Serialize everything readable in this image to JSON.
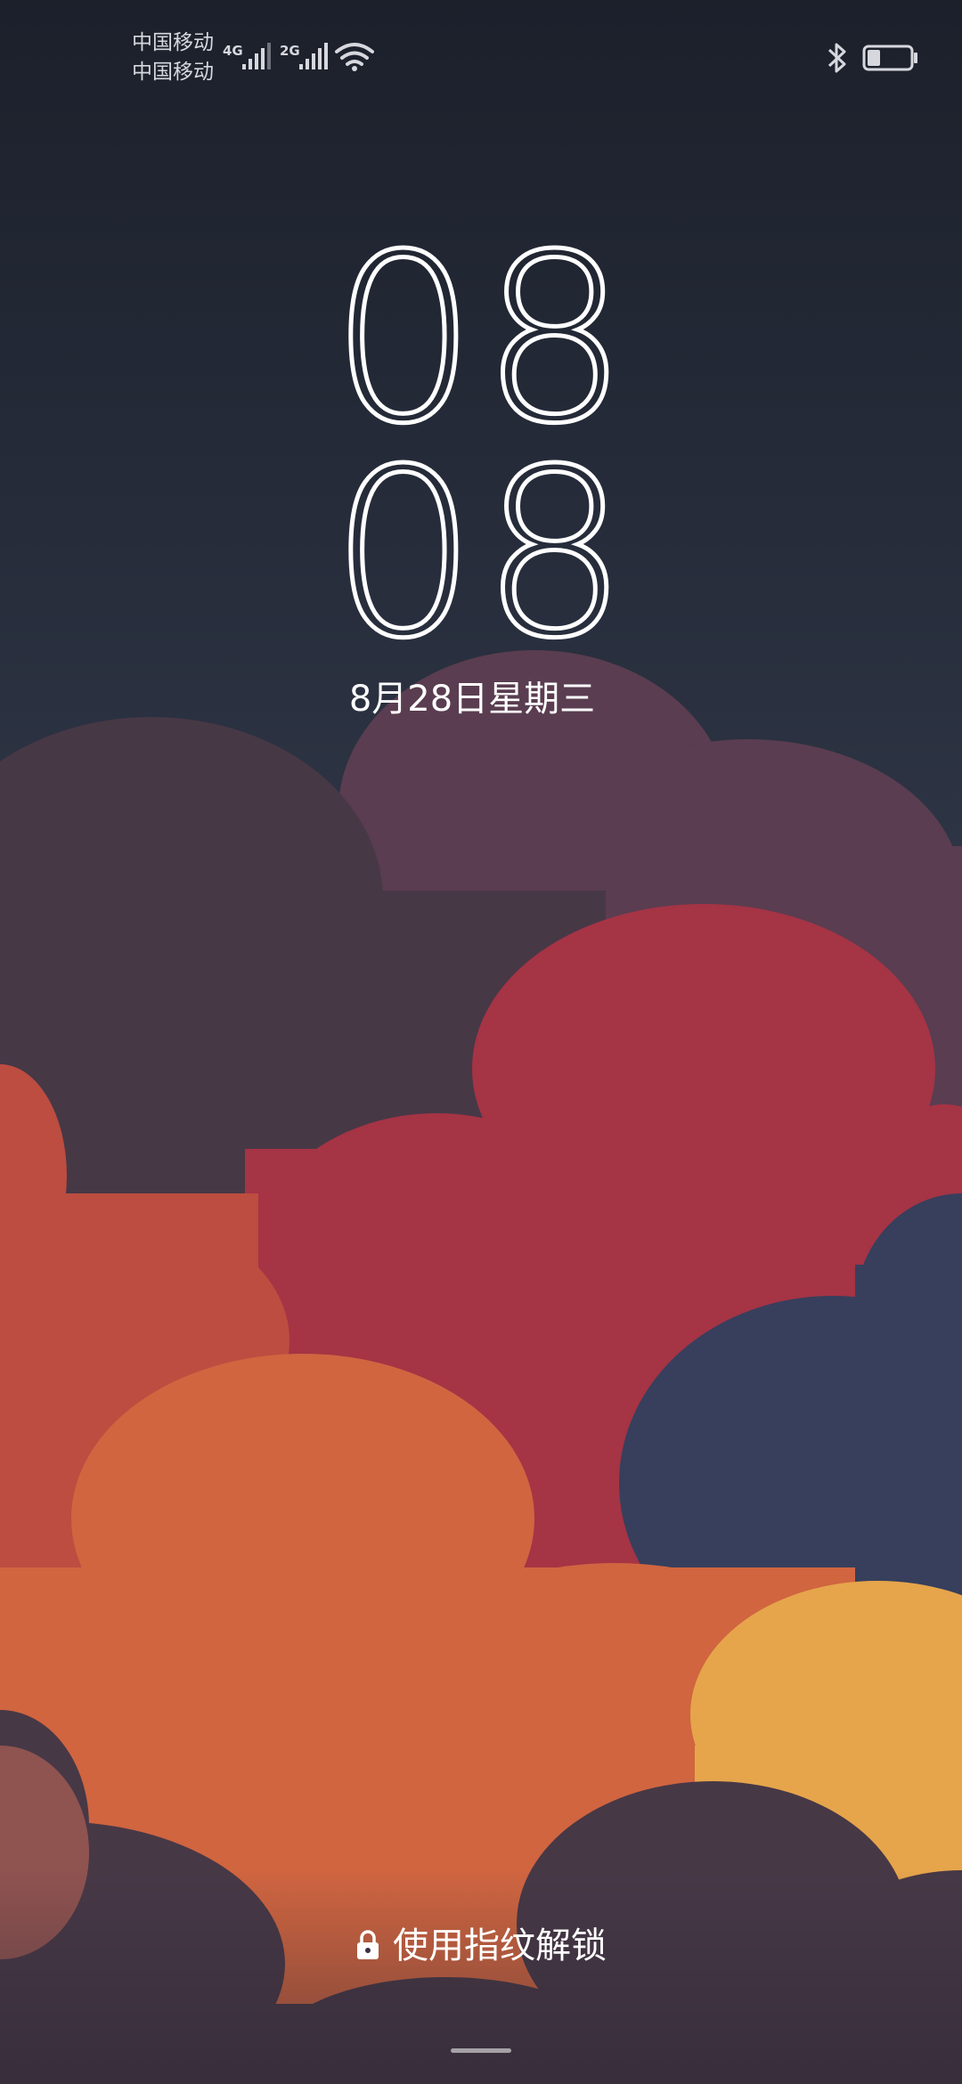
{
  "status_bar": {
    "carriers": [
      "中国移动",
      "中国移动"
    ],
    "sim1_network": "4G",
    "sim2_network": "2G",
    "icons": [
      "signal-icon",
      "signal-icon",
      "wifi-icon",
      "bluetooth-icon",
      "battery-icon"
    ]
  },
  "lockscreen": {
    "clock_hours": "08",
    "clock_minutes": "08",
    "date": "8月28日星期三",
    "unlock_hint": "使用指纹解锁"
  },
  "colors": {
    "plum": "#5a3d50",
    "dark_plum": "#473846",
    "crimson": "#a53445",
    "rust": "#bc4d40",
    "orange": "#d06540",
    "navy": "#373f5c",
    "gold": "#e6a54b"
  }
}
